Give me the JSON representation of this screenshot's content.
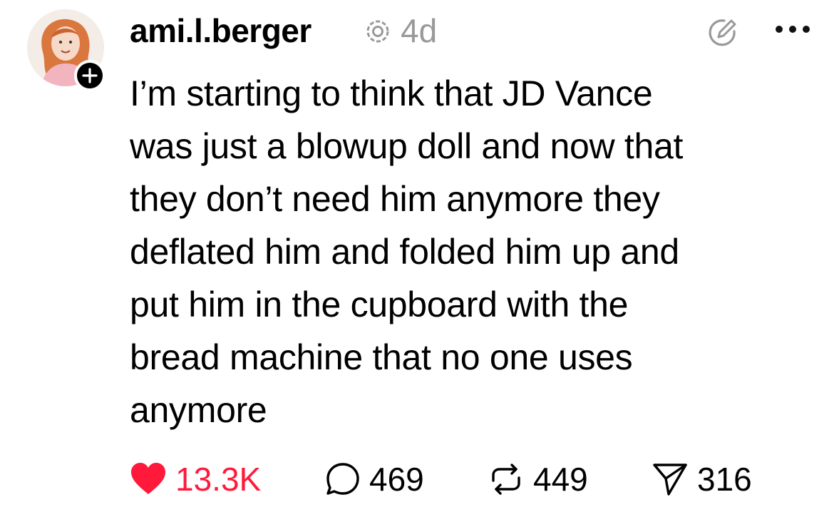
{
  "post": {
    "username": "ami.l.berger",
    "time": "4d",
    "text": "I’m starting to think that JD Vance\nwas just a blowup doll and now that\nthey don’t need him anymore they\ndeflated him and folded him up and\nput him in the cupboard with the\nbread machine that no one uses\nanymore"
  },
  "actions": {
    "likes": "13.3K",
    "replies": "469",
    "reposts": "449",
    "shares": "316"
  },
  "icons": {
    "avatar": "avatar",
    "follow": "plus-icon",
    "meta": "threads-icon",
    "edit": "edit-icon",
    "more": "more-icon",
    "like": "heart-icon",
    "reply": "reply-icon",
    "repost": "repost-icon",
    "share": "share-icon"
  },
  "colors": {
    "like": "#ff1a3c",
    "muted": "#999999",
    "text": "#000000"
  }
}
